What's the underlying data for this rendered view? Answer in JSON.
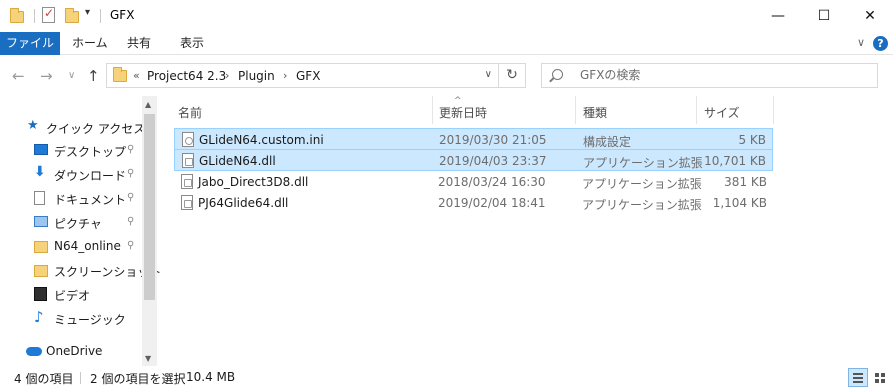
{
  "window": {
    "title": "GFX",
    "minimize_glyph": "—",
    "maximize_glyph": "☐",
    "close_glyph": "✕",
    "qa_dropdown_glyph": "▾"
  },
  "ribbon": {
    "tabs": [
      "ファイル",
      "ホーム",
      "共有",
      "表示"
    ],
    "toggle_glyph": "∨",
    "help_glyph": "?"
  },
  "nav_buttons": {
    "back": "←",
    "forward": "→",
    "recent": "∨",
    "up": "↑"
  },
  "address": {
    "overflow": "«",
    "crumbs": [
      "Project64 2.3",
      "Plugin",
      "GFX"
    ],
    "separator": "›",
    "dropdown_glyph": "∨",
    "refresh_glyph": "↻"
  },
  "search": {
    "placeholder": "GFXの検索"
  },
  "navigation": {
    "quick_access": "クイック アクセス",
    "items": [
      {
        "label": "デスクトップ",
        "icon": "desktop-icon",
        "pinned": true
      },
      {
        "label": "ダウンロード",
        "icon": "download-icon",
        "pinned": true
      },
      {
        "label": "ドキュメント",
        "icon": "documents-icon",
        "pinned": true
      },
      {
        "label": "ピクチャ",
        "icon": "pictures-icon",
        "pinned": true
      },
      {
        "label": "N64_online",
        "icon": "folder-icon",
        "pinned": true
      },
      {
        "label": "スクリーンショット",
        "icon": "folder-icon",
        "pinned": false
      },
      {
        "label": "ビデオ",
        "icon": "video-icon",
        "pinned": false
      },
      {
        "label": "ミュージック",
        "icon": "music-icon",
        "pinned": false
      }
    ],
    "onedrive": "OneDrive",
    "pin_glyph": "📌"
  },
  "columns": {
    "name": "名前",
    "date": "更新日時",
    "type": "種類",
    "size": "サイズ",
    "sort_glyph": "^"
  },
  "files": [
    {
      "name": "GLideN64.custom.ini",
      "date": "2019/03/30 21:05",
      "type": "構成設定",
      "size": "5 KB",
      "selected": true,
      "icon": "ini-file-icon"
    },
    {
      "name": "GLideN64.dll",
      "date": "2019/04/03 23:37",
      "type": "アプリケーション拡張",
      "size": "10,701 KB",
      "selected": true,
      "icon": "dll-file-icon"
    },
    {
      "name": "Jabo_Direct3D8.dll",
      "date": "2018/03/24 16:30",
      "type": "アプリケーション拡張",
      "size": "381 KB",
      "selected": false,
      "icon": "dll-file-icon"
    },
    {
      "name": "PJ64Glide64.dll",
      "date": "2019/02/04 18:41",
      "type": "アプリケーション拡張",
      "size": "1,104 KB",
      "selected": false,
      "icon": "dll-file-icon"
    }
  ],
  "status": {
    "item_count": "4 個の項目",
    "selection": "2 個の項目を選択",
    "selection_size": "10.4 MB"
  },
  "colors": {
    "accent": "#1a6ec1",
    "selection_bg": "#cce8ff",
    "selection_border": "#99d1ff"
  }
}
